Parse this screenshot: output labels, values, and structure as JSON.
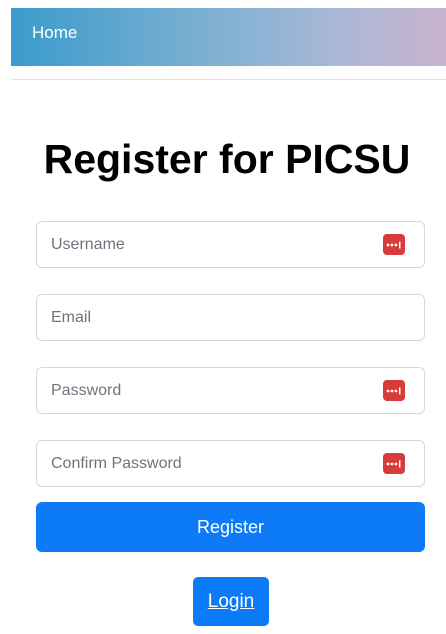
{
  "nav": {
    "home_label": "Home"
  },
  "page": {
    "title": "Register for PICSU"
  },
  "form": {
    "username": {
      "placeholder": "Username",
      "value": ""
    },
    "email": {
      "placeholder": "Email",
      "value": ""
    },
    "password": {
      "placeholder": "Password",
      "value": ""
    },
    "confirm_password": {
      "placeholder": "Confirm Password",
      "value": ""
    },
    "password_manager_icon": "password-manager-icon",
    "register_label": "Register"
  },
  "footer": {
    "login_label": "Login"
  },
  "colors": {
    "primary": "#0d7bf7",
    "password_manager_icon": "#d93a3a",
    "nav_gradient_start": "#3a9bcc",
    "nav_gradient_end": "#c8b3cf"
  }
}
